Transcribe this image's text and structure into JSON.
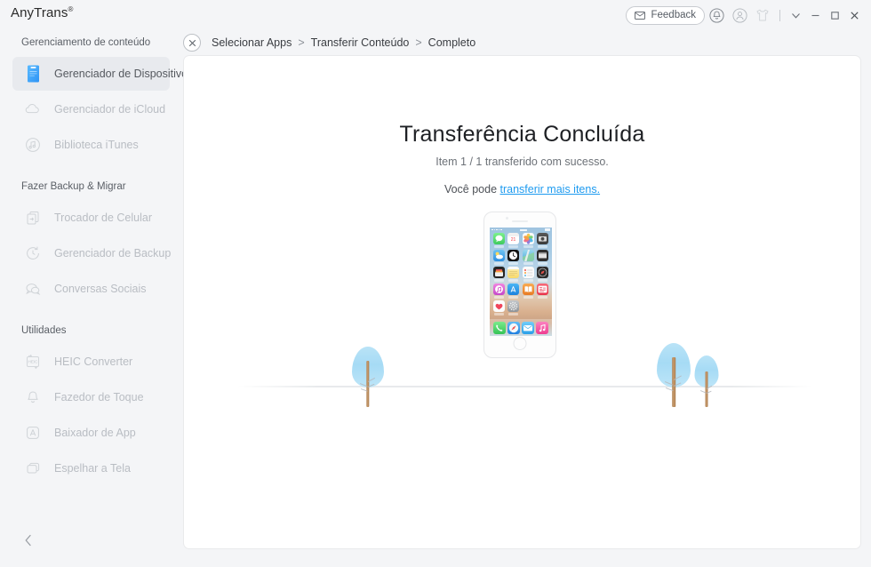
{
  "app": {
    "brand": "AnyTrans",
    "brand_mark": "®"
  },
  "titlebar": {
    "feedback_label": "Feedback",
    "icons": [
      {
        "name": "envelope-icon"
      },
      {
        "name": "bell-icon"
      },
      {
        "name": "user-account-icon"
      },
      {
        "name": "tshirt-store-icon"
      }
    ],
    "window_controls": [
      {
        "name": "chevron-down-icon",
        "glyph": "∨"
      },
      {
        "name": "minimize-icon",
        "glyph": "−"
      },
      {
        "name": "maximize-icon",
        "glyph": "□"
      },
      {
        "name": "close-icon",
        "glyph": "✕"
      }
    ]
  },
  "sidebar": {
    "sections": [
      {
        "title": "Gerenciamento de conteúdo",
        "items": [
          {
            "label": "Gerenciador de Dispositivo",
            "icon": "device-icon",
            "active": true
          },
          {
            "label": "Gerenciador de iCloud",
            "icon": "cloud-icon",
            "active": false
          },
          {
            "label": "Biblioteca iTunes",
            "icon": "itunes-note-icon",
            "active": false
          }
        ]
      },
      {
        "title": "Fazer Backup & Migrar",
        "items": [
          {
            "label": "Trocador de Celular",
            "icon": "phone-switcher-icon",
            "active": false
          },
          {
            "label": "Gerenciador de Backup",
            "icon": "backup-clock-icon",
            "active": false
          },
          {
            "label": "Conversas Sociais",
            "icon": "chat-bubbles-icon",
            "active": false
          }
        ]
      },
      {
        "title": "Utilidades",
        "items": [
          {
            "label": "HEIC Converter",
            "icon": "heic-convert-icon",
            "active": false
          },
          {
            "label": "Fazedor de Toque",
            "icon": "bell-ringtone-icon",
            "active": false
          },
          {
            "label": "Baixador de App",
            "icon": "app-store-icon",
            "active": false
          },
          {
            "label": "Espelhar a Tela",
            "icon": "screen-mirror-icon",
            "active": false
          }
        ]
      }
    ],
    "collapse": {
      "name": "collapse-sidebar-icon",
      "glyph": "‹"
    }
  },
  "breadcrumb": {
    "close": {
      "name": "close-task-icon",
      "glyph": "✕"
    },
    "steps": [
      "Selecionar Apps",
      "Transferir Conteúdo",
      "Completo"
    ],
    "separator": ">"
  },
  "main": {
    "headline": "Transferência Concluída",
    "subline": "Item 1 / 1 transferido com sucesso.",
    "link_prefix": "Você pode ",
    "link_text": "transferir mais itens.",
    "link_color": "#1e9bf0"
  },
  "illustration": {
    "device": "iphone-se-home-screen",
    "home_apps": [
      {
        "name": "messages-icon",
        "color": "#5de078"
      },
      {
        "name": "calendar-icon",
        "color": "#ffffff"
      },
      {
        "name": "photos-icon",
        "color": "#f4f4f4"
      },
      {
        "name": "camera-icon",
        "color": "#4a4a4a"
      },
      {
        "name": "weather-icon",
        "color": "#4aa8e8"
      },
      {
        "name": "clock-icon",
        "color": "#1c1c1c"
      },
      {
        "name": "maps-icon",
        "color": "#67b6e6"
      },
      {
        "name": "videos-icon",
        "color": "#2f2f2f"
      },
      {
        "name": "wallet-icon",
        "color": "#2b2b2b"
      },
      {
        "name": "notes-icon",
        "color": "#fbe38a"
      },
      {
        "name": "reminders-icon",
        "color": "#fafafa"
      },
      {
        "name": "compass-icon",
        "color": "#2a2a2a"
      },
      {
        "name": "itunes-store-icon",
        "color": "#e45fd0"
      },
      {
        "name": "app-store-icon",
        "color": "#2c9ae8"
      },
      {
        "name": "ibooks-icon",
        "color": "#f09030"
      },
      {
        "name": "news-icon",
        "color": "#ef4b5a"
      },
      {
        "name": "health-icon",
        "color": "#fbfbfb"
      },
      {
        "name": "settings-icon",
        "color": "#9fa3a8"
      }
    ],
    "dock_apps": [
      {
        "name": "phone-icon",
        "color": "#4cd964"
      },
      {
        "name": "safari-icon",
        "color": "#2f9ff0"
      },
      {
        "name": "mail-icon",
        "color": "#3fb6f5"
      },
      {
        "name": "music-icon",
        "color": "#f54fa6"
      }
    ],
    "trees": [
      {
        "name": "tree-left",
        "canopy_color": "#a6dbf5",
        "trunk_color": "#c79a6b"
      },
      {
        "name": "tree-right-large",
        "canopy_color": "#a6dbf5",
        "trunk_color": "#c79a6b"
      },
      {
        "name": "tree-right-small",
        "canopy_color": "#a6dbf5",
        "trunk_color": "#c79a6b"
      }
    ],
    "ground_color": "#e8eaec"
  },
  "colors": {
    "sidebar_bg": "#f4f5f7",
    "panel_bg": "#ffffff",
    "active_item_bg": "#e8eaee",
    "accent_blue": "#1e9bf0",
    "device_icon_blue": "#37a4ff"
  }
}
